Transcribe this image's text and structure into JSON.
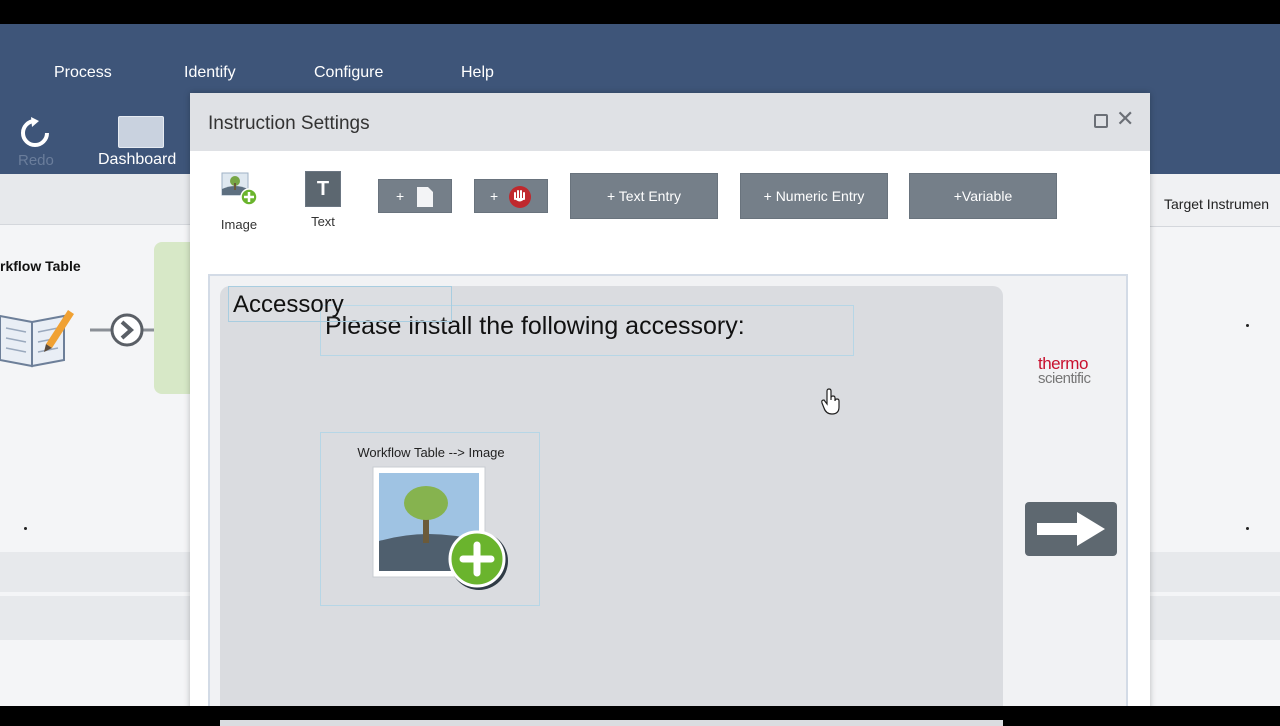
{
  "menu": {
    "items": [
      "Process",
      "Identify",
      "Configure",
      "Help"
    ]
  },
  "toolbar": {
    "redo_label": "Redo",
    "dashboard_label": "Dashboard"
  },
  "background": {
    "workflow_label": "rkflow Table",
    "target_label": "Target Instrumen"
  },
  "dialog": {
    "title": "Instruction Settings",
    "tools": {
      "image_label": "Image",
      "text_label": "Text",
      "text_icon": "T",
      "add_page_label": "+",
      "add_stop_label": "+",
      "text_entry_label": "+ Text Entry",
      "numeric_entry_label": "+ Numeric Entry",
      "variable_label": "+Variable"
    },
    "canvas": {
      "accessory_label": "Accessory",
      "instruction_text": "Please install the following accessory:",
      "image_caption": "Workflow Table --> Image"
    },
    "logo": {
      "line1": "thermo",
      "line2": "scientific"
    }
  },
  "colors": {
    "menubar": "#3e5579",
    "button_gray": "#757f89",
    "logo_red": "#c8102e",
    "add_green": "#6ab42d"
  }
}
